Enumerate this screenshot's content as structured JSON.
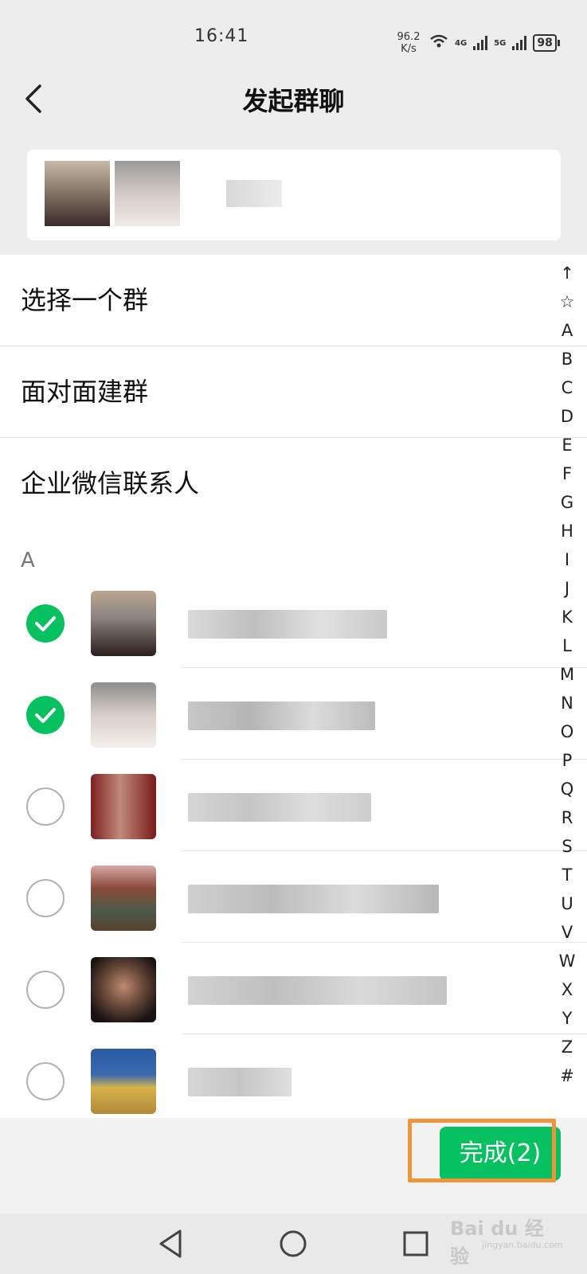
{
  "status": {
    "time": "16:41",
    "net_speed_value": "96.2",
    "net_speed_unit": "K/s",
    "signal1": "4G",
    "signal2": "5G",
    "battery": "98"
  },
  "header": {
    "title": "发起群聊"
  },
  "menu": {
    "items": [
      {
        "label": "选择一个群"
      },
      {
        "label": "面对面建群"
      },
      {
        "label": "企业微信联系人"
      }
    ]
  },
  "contacts": {
    "section": "A",
    "items": [
      {
        "selected": true
      },
      {
        "selected": true
      },
      {
        "selected": false
      },
      {
        "selected": false
      },
      {
        "selected": false
      },
      {
        "selected": false
      }
    ]
  },
  "index_letters": [
    "↑",
    "☆",
    "A",
    "B",
    "C",
    "D",
    "E",
    "F",
    "G",
    "H",
    "I",
    "J",
    "K",
    "L",
    "M",
    "N",
    "O",
    "P",
    "Q",
    "R",
    "S",
    "T",
    "U",
    "V",
    "W",
    "X",
    "Y",
    "Z",
    "#"
  ],
  "footer": {
    "done_label": "完成(2)"
  },
  "watermark": {
    "brand": "Bai du 经验",
    "url": "jingyan.baidu.com"
  },
  "colors": {
    "accent": "#07c160",
    "highlight": "#f0943a"
  }
}
